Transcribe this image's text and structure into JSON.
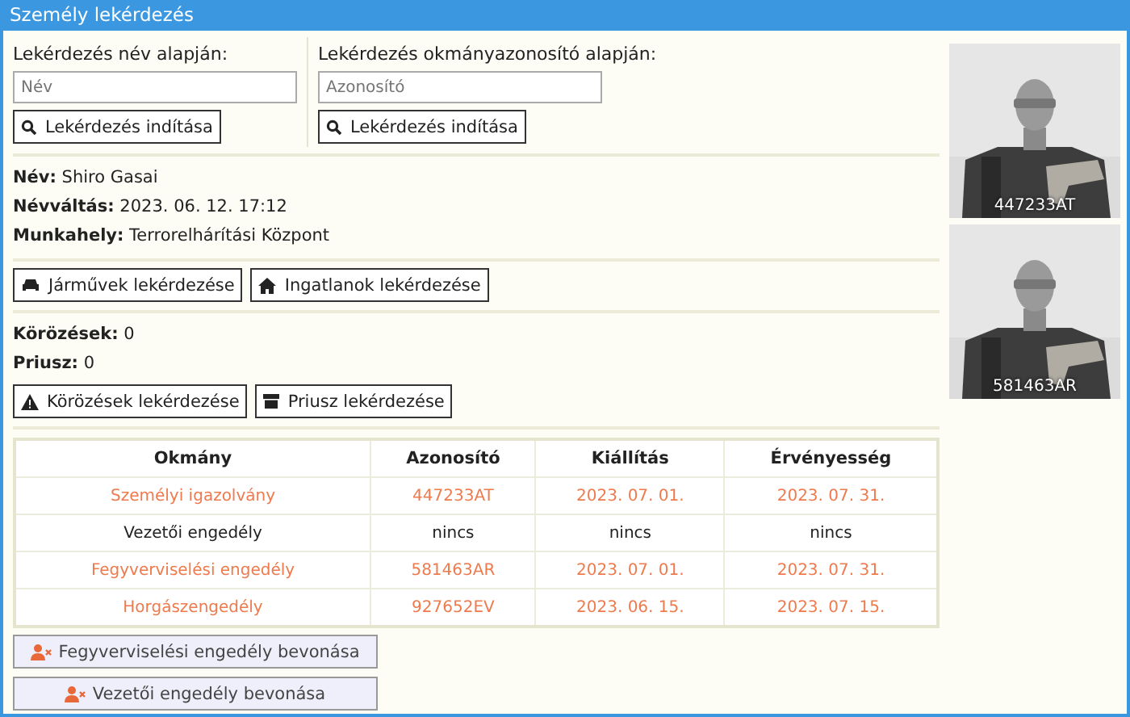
{
  "window": {
    "title": "Személy lekérdezés"
  },
  "search_panels": [
    {
      "label": "Lekérdezés név alapján:",
      "placeholder": "Név",
      "button": "Lekérdezés indítása"
    },
    {
      "label": "Lekérdezés okmányazonosító alapján:",
      "placeholder": "Azonosító",
      "button": "Lekérdezés indítása"
    }
  ],
  "person": [
    {
      "label": "Név:",
      "value": "Shiro Gasai"
    },
    {
      "label": "Névváltás:",
      "value": "2023. 06. 12. 17:12"
    },
    {
      "label": "Munkahely:",
      "value": "Terrorelhárítási Központ"
    }
  ],
  "query_buttons": [
    {
      "kind": "car",
      "label": "Járművek lekérdezése"
    },
    {
      "kind": "house",
      "label": "Ingatlanok lekérdezése"
    }
  ],
  "records": [
    {
      "label": "Körözések:",
      "value": "0"
    },
    {
      "label": "Priusz:",
      "value": "0"
    }
  ],
  "record_buttons": [
    {
      "kind": "warning",
      "label": "Körözések lekérdezése"
    },
    {
      "kind": "archive",
      "label": "Priusz lekérdezése"
    }
  ],
  "table": {
    "columns": [
      "Okmány",
      "Azonosító",
      "Kiállítás",
      "Érvényesség"
    ],
    "rows": [
      {
        "highlighted": true,
        "cells": [
          "Személyi igazolvány",
          "447233AT",
          "2023. 07. 01.",
          "2023. 07. 31."
        ]
      },
      {
        "highlighted": false,
        "cells": [
          "Vezetői engedély",
          "nincs",
          "nincs",
          "nincs"
        ]
      },
      {
        "highlighted": true,
        "cells": [
          "Fegyverviselési engedély",
          "581463AR",
          "2023. 07. 01.",
          "2023. 07. 31."
        ]
      },
      {
        "highlighted": true,
        "cells": [
          "Horgászengedély",
          "927652EV",
          "2023. 06. 15.",
          "2023. 07. 15."
        ]
      }
    ]
  },
  "revoke_buttons": [
    "Fegyverviselési engedély bevonása",
    "Vezetői engedély bevonása"
  ],
  "photos": [
    {
      "kind": "picture",
      "caption": "447233AT"
    },
    {
      "kind": "picture",
      "caption": "581463AR"
    }
  ]
}
